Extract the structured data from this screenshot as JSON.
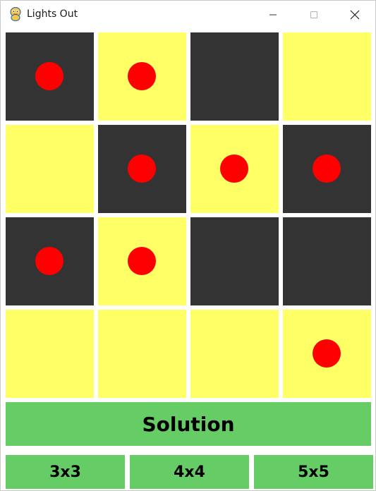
{
  "window": {
    "title": "Lights Out",
    "app_icon": "python-snake-icon",
    "controls": [
      "minimize-icon",
      "maximize-icon",
      "close-icon"
    ]
  },
  "board": {
    "size": 4,
    "colors": {
      "on": "#ffff66",
      "off": "#333333",
      "marker": "#ff0000"
    },
    "rows": [
      [
        {
          "lit": false,
          "marked": true
        },
        {
          "lit": true,
          "marked": true
        },
        {
          "lit": false,
          "marked": false
        },
        {
          "lit": true,
          "marked": false
        }
      ],
      [
        {
          "lit": true,
          "marked": false
        },
        {
          "lit": false,
          "marked": true
        },
        {
          "lit": true,
          "marked": true
        },
        {
          "lit": false,
          "marked": true
        }
      ],
      [
        {
          "lit": false,
          "marked": true
        },
        {
          "lit": true,
          "marked": true
        },
        {
          "lit": false,
          "marked": false
        },
        {
          "lit": false,
          "marked": false
        }
      ],
      [
        {
          "lit": true,
          "marked": false
        },
        {
          "lit": true,
          "marked": false
        },
        {
          "lit": true,
          "marked": false
        },
        {
          "lit": true,
          "marked": true
        }
      ]
    ]
  },
  "controls": {
    "solution_label": "Solution",
    "size_options": [
      "3x3",
      "4x4",
      "5x5"
    ],
    "button_color": "#66cc66"
  }
}
